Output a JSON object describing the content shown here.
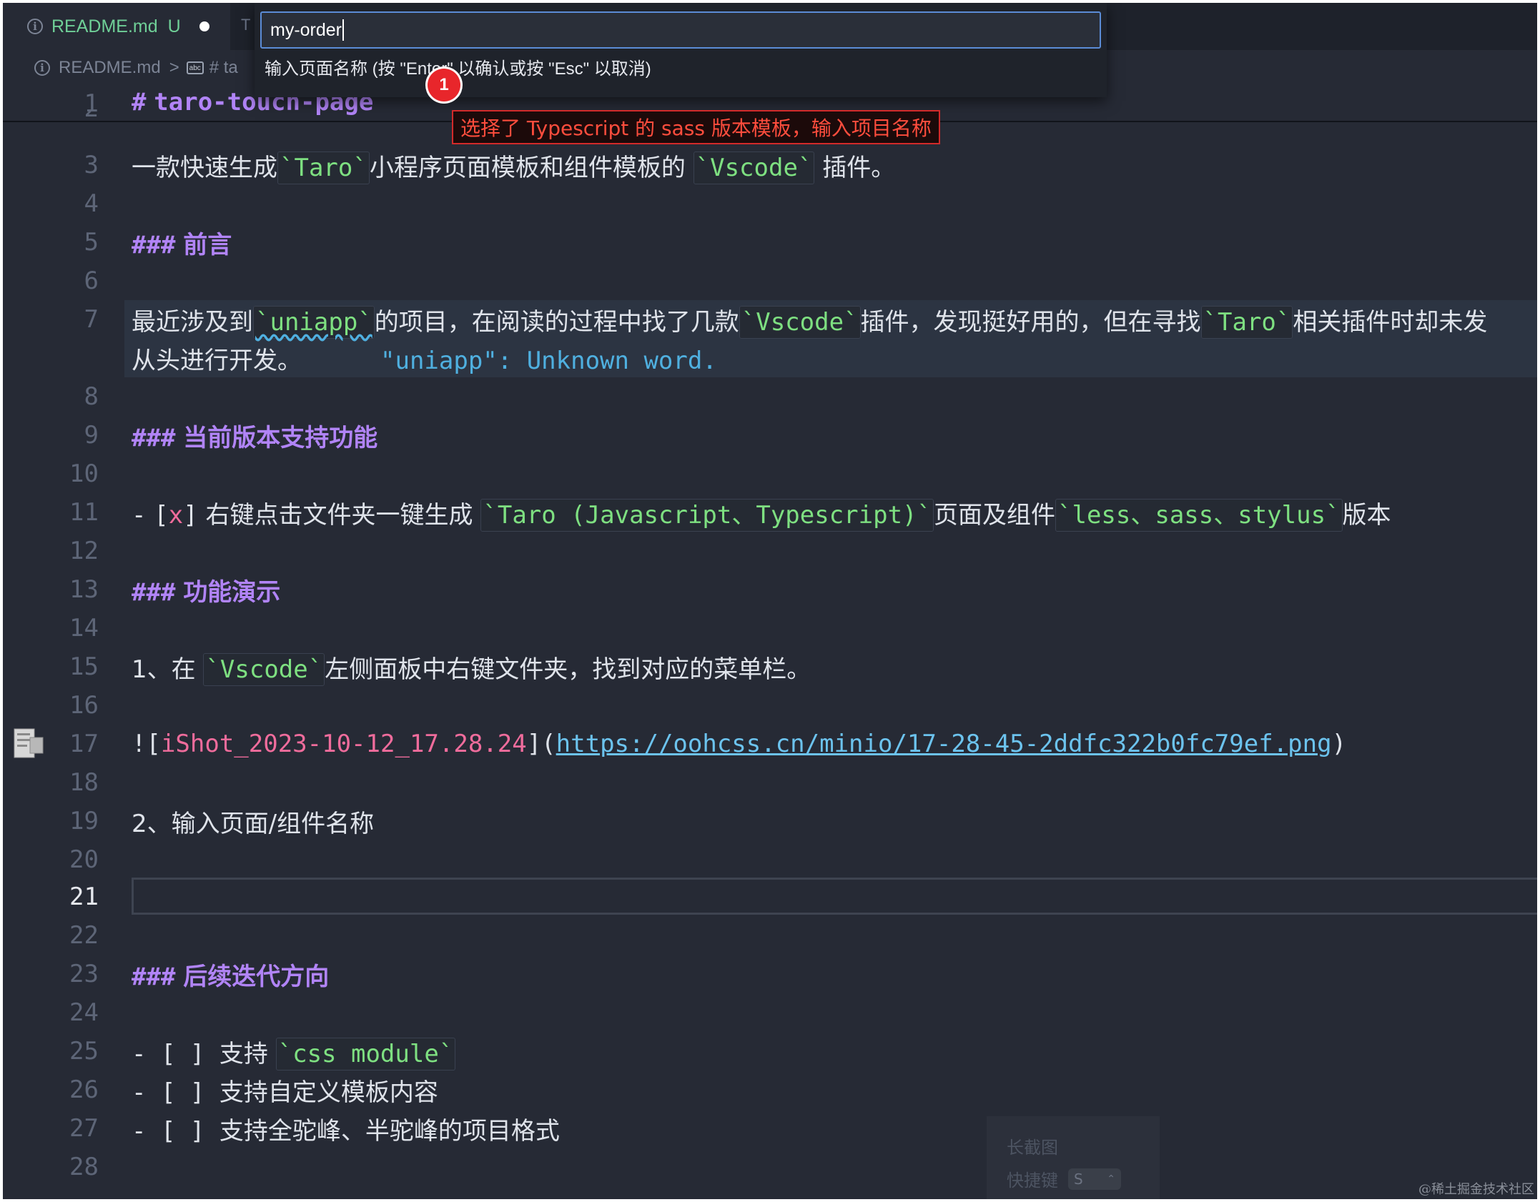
{
  "tab": {
    "title": "README.md",
    "badge": "U",
    "second_tab_letter": "T"
  },
  "breadcrumb": {
    "file": "README.md",
    "separator": ">",
    "symbol": "# ta"
  },
  "quick_input": {
    "value": "my-order",
    "hint": "输入页面名称 (按 \"Enter\" 以确认或按 \"Esc\" 以取消)"
  },
  "annotation": {
    "marker": "1",
    "callout": "选择了 Typescript 的 sass 版本模板，输入项目名称"
  },
  "editor": {
    "active_line": "21",
    "line_numbers": [
      "1",
      "2",
      "3",
      "4",
      "5",
      "6",
      "7",
      "8",
      "9",
      "10",
      "11",
      "12",
      "13",
      "14",
      "15",
      "16",
      "17",
      "18",
      "19",
      "20",
      "21",
      "22",
      "23",
      "24",
      "25",
      "26",
      "27",
      "28"
    ],
    "l1": {
      "mark": "#",
      "text": "taro-touch-page"
    },
    "l3": {
      "t1": "一款快速生成",
      "c1": "`Taro`",
      "t2": "小程序页面模板和组件模板的 ",
      "c2": "`Vscode`",
      "t3": " 插件。"
    },
    "l5": {
      "mark": "###",
      "text": "前言"
    },
    "l7": {
      "t1": "最近涉及到",
      "c1": "`uniapp`",
      "t2": "的项目，在阅读的过程中找了几款",
      "c2": "`Vscode`",
      "t3": "插件，发现挺好用的，但在寻找",
      "c3": "`Taro`",
      "t4": "相关插件时却未发",
      "wrap": "从头进行开发。",
      "diagnostic": "\"uniapp\": Unknown word."
    },
    "l9": {
      "mark": "###",
      "text": "当前版本支持功能"
    },
    "l11": {
      "dash": "-",
      "ob": "[",
      "x": "x",
      "cb": "]",
      "t1": " 右键点击文件夹一键生成 ",
      "c1": "`Taro (Javascript、Typescript)`",
      "t2": "页面及组件",
      "c2": "`less、sass、stylus`",
      "t3": "版本"
    },
    "l13": {
      "mark": "###",
      "text": "功能演示"
    },
    "l15": {
      "t1": "1、在 ",
      "c1": "`Vscode`",
      "t2": "左侧面板中右键文件夹，找到对应的菜单栏。"
    },
    "l17": {
      "open": "![",
      "alt": "iShot_2023-10-12_17.28.24",
      "mid": "](",
      "url": "https://oohcss.cn/minio/17-28-45-2ddfc322b0fc79ef.png",
      "close": ")"
    },
    "l19": {
      "text": "2、输入页面/组件名称"
    },
    "l23": {
      "mark": "###",
      "text": "后续迭代方向"
    },
    "l25": {
      "prefix": "- [ ] ",
      "t1": "支持 ",
      "c1": "`css module`"
    },
    "l26": {
      "prefix": "- [ ] ",
      "t1": "支持自定义模板内容"
    },
    "l27": {
      "prefix": "- [ ] ",
      "t1": "支持全驼峰、半驼峰的项目格式"
    }
  },
  "overlay": {
    "title": "长截图",
    "shortcut_label": "快捷键",
    "shortcut_key": "S"
  },
  "watermark": "@稀土掘金技术社区"
}
